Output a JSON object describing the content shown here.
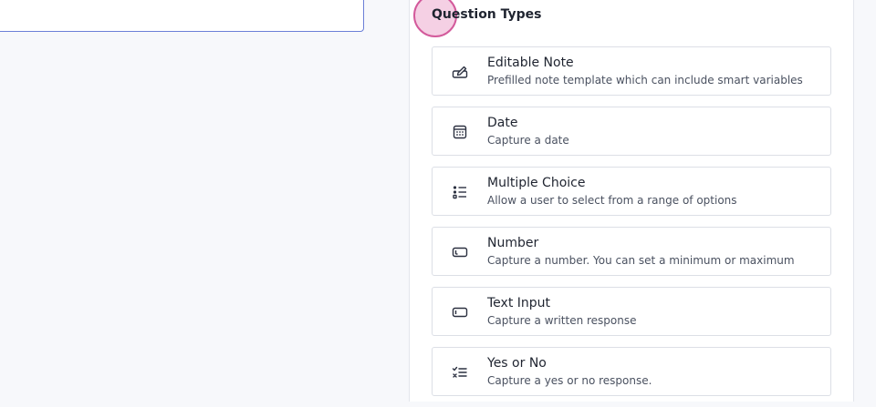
{
  "panel": {
    "title": "Question Types"
  },
  "question_types": [
    {
      "icon": "edit-note-icon",
      "title": "Editable Note",
      "description": "Prefilled note template which can include smart variables"
    },
    {
      "icon": "calendar-icon",
      "title": "Date",
      "description": "Capture a date"
    },
    {
      "icon": "list-icon",
      "title": "Multiple Choice",
      "description": "Allow a user to select from a range of options"
    },
    {
      "icon": "number-input-icon",
      "title": "Number",
      "description": "Capture a number. You can set a minimum or maximum"
    },
    {
      "icon": "text-input-icon",
      "title": "Text Input",
      "description": "Capture a written response"
    },
    {
      "icon": "check-x-list-icon",
      "title": "Yes or No",
      "description": "Capture a yes or no response."
    }
  ]
}
